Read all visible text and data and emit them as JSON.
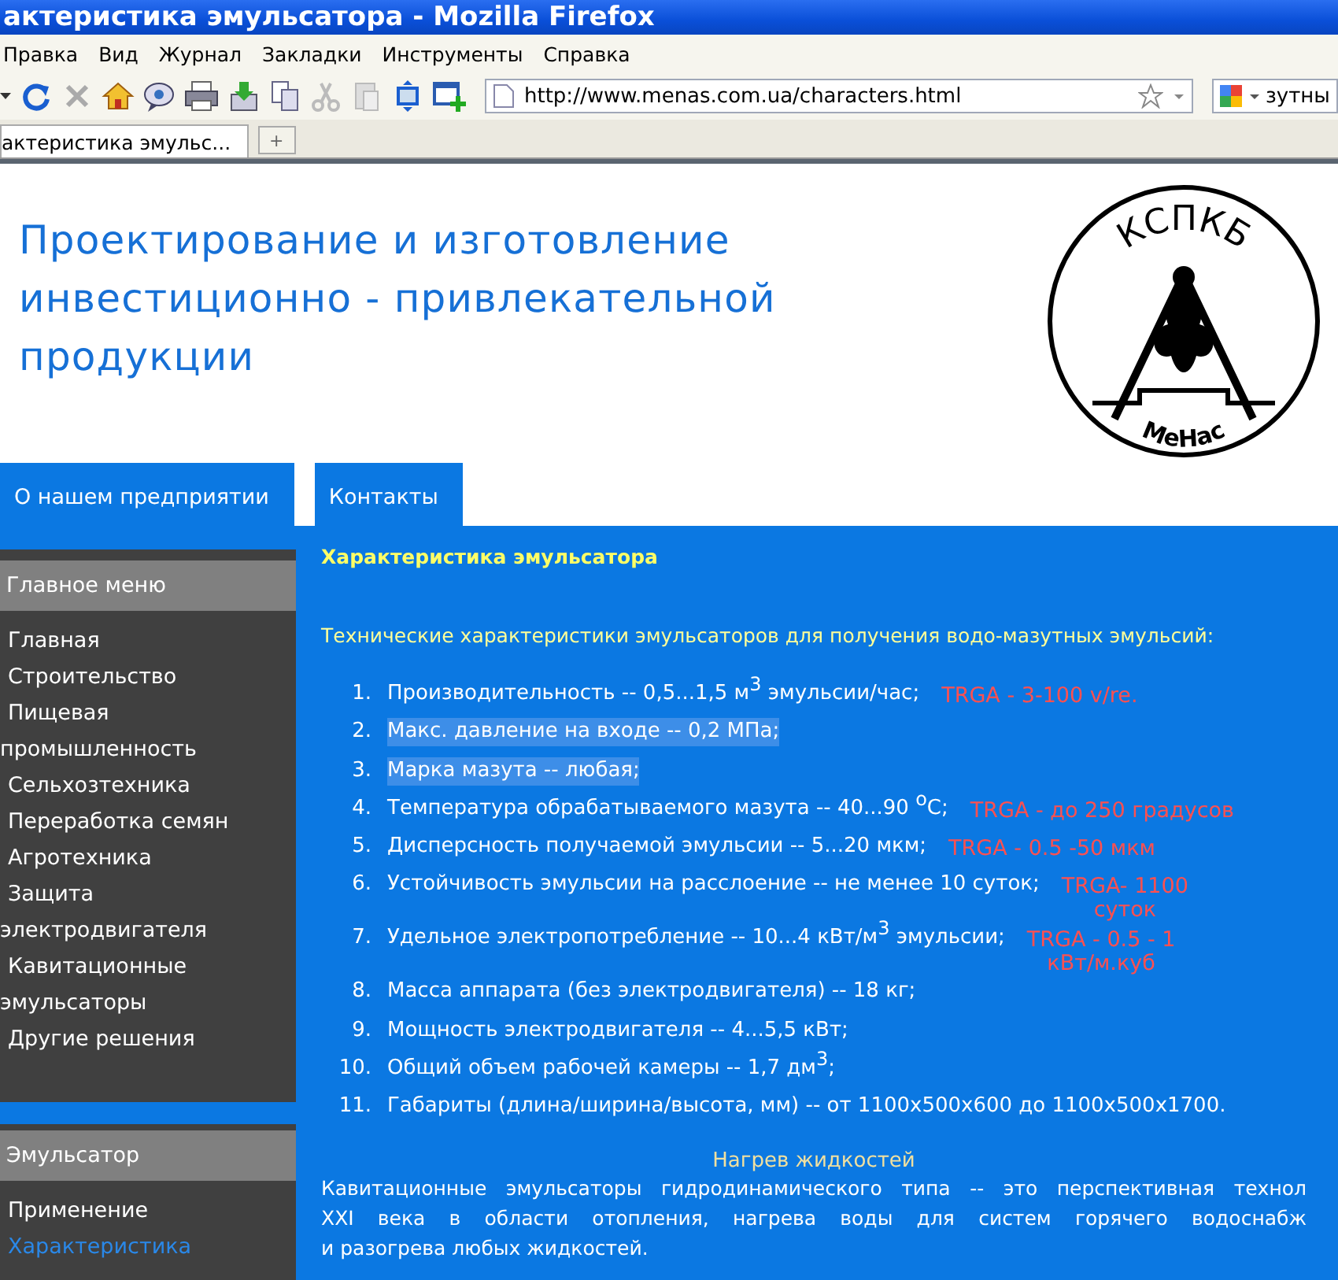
{
  "window": {
    "title": "актеристика эмульсатора - Mozilla Firefox"
  },
  "menu_bar": [
    "Правка",
    "Вид",
    "Журнал",
    "Закладки",
    "Инструменты",
    "Справка"
  ],
  "address_bar": {
    "value": "http://www.menas.com.ua/characters.html"
  },
  "search_field": {
    "value": "зутны"
  },
  "tabs": [
    {
      "label": "актеристика эмульс...",
      "selected": true
    }
  ],
  "new_tab": "+",
  "header": {
    "heading": "Проектирование и изготовление инвестиционно - привлекательной продукции",
    "logo": {
      "top": "КСПКБ",
      "bottom": "МеНас"
    }
  },
  "nav_tabs": [
    {
      "label": "О нашем предприятии"
    },
    {
      "label": "Контакты"
    }
  ],
  "sidebar": {
    "menus": [
      {
        "title": "Главное меню",
        "items": [
          {
            "label": "Главная",
            "selected": false
          },
          {
            "label": "Строительство",
            "selected": false
          },
          {
            "label": "Пищевая промышленность",
            "selected": false
          },
          {
            "label": "Сельхозтехника",
            "selected": false
          },
          {
            "label": "Переработка семян",
            "selected": false
          },
          {
            "label": "Агротехника",
            "selected": false
          },
          {
            "label": "Защита электродвигателя",
            "selected": false
          },
          {
            "label": "Кавитационные эмульсаторы",
            "selected": false
          },
          {
            "label": "Другие решения",
            "selected": false
          }
        ]
      },
      {
        "title": "Эмульсатор",
        "items": [
          {
            "label": "Применение",
            "selected": false
          },
          {
            "label": "Характеристика",
            "selected": true
          }
        ]
      }
    ]
  },
  "content": {
    "title": "Характеристика эмульсатора",
    "intro": "Технические характеристики эмульсаторов для получения водо-мазутных эмульсий:",
    "specs": [
      {
        "number": "1.",
        "text": "Производительность -- 0,5...1,5 м$^{3}$ эмульсии/час;",
        "highlighted": false,
        "note": "TRGA - 3-100 v/re."
      },
      {
        "number": "2.",
        "text": "Макс. давление на входе -- 0,2 МПа;",
        "highlighted": true
      },
      {
        "number": "3.",
        "text": "Марка мазута -- любая;",
        "highlighted": true
      },
      {
        "number": "4.",
        "text": "Температура обрабатываемого мазута -- 40...90 $^{o}$C;",
        "highlighted": false,
        "note": "TRGA - до 250 градусов"
      },
      {
        "number": "5.",
        "text": "Дисперсность получаемой эмульсии -- 5...20 мкм;",
        "highlighted": false,
        "note": "TRGA - 0.5 -50 мкм"
      },
      {
        "number": "6.",
        "text": "Устойчивость эмульсии на расслоение -- не менее 10 суток;",
        "highlighted": false,
        "note": "TRGA- 1100\nсуток"
      },
      {
        "number": "7.",
        "text": "Удельное электропотребление -- 10...4 кВт/м$^{3}$ эмульсии;",
        "highlighted": false,
        "note": "TRGA - 0.5 - 1\nкВт/м.куб"
      },
      {
        "number": "8.",
        "text": "Масса аппарата (без электродвигателя) -- 18 кг;",
        "highlighted": false
      },
      {
        "number": "9.",
        "text": "Мощность электродвигателя -- 4...5,5 кВт;",
        "highlighted": false
      },
      {
        "number": "10.",
        "text": "Общий объем рабочей камеры -- 1,7 дм$^{3}$;",
        "highlighted": false
      },
      {
        "number": "11.",
        "text": "Габариты (длина/ширина/высота, мм) -- от 1100x500x600 до 1100x500x1700.",
        "highlighted": false
      }
    ],
    "subheading": "Нагрев жидкостей",
    "paragraph_lines": [
      "Кавитационные эмульсаторы гидродинамического типа -- это перспективная технол",
      "XXI века  в области отопления, нагрева воды для систем горячего водоснабж",
      "и разогрева любых жидкостей."
    ]
  }
}
